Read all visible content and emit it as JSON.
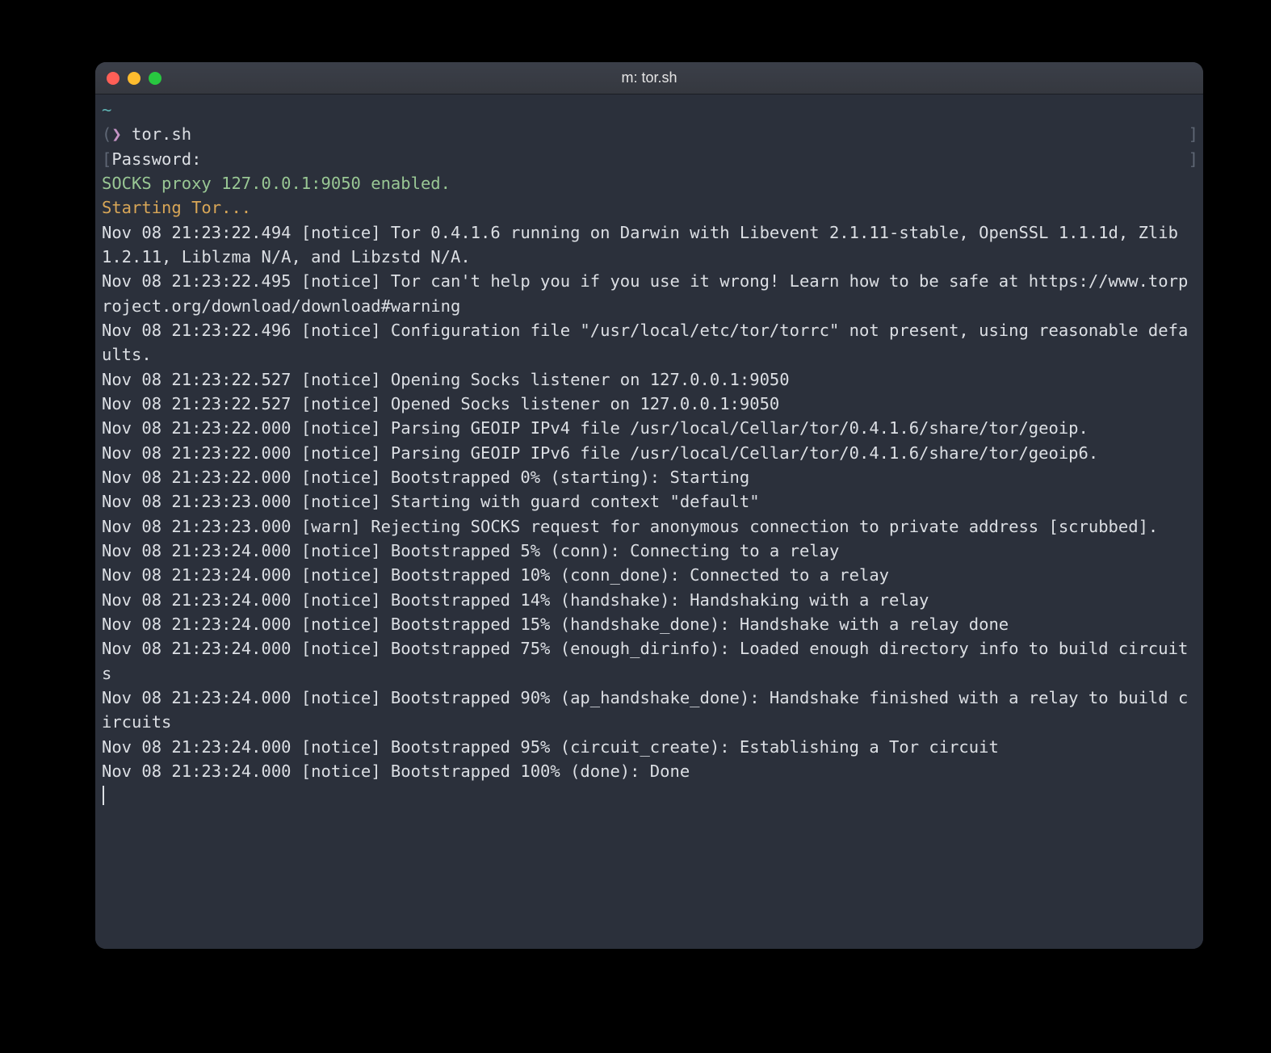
{
  "window": {
    "title": "m: tor.sh"
  },
  "prompt": {
    "cwd": "~",
    "left_bracket": "(",
    "arrow": "❯",
    "command": "tor.sh",
    "right_bracket": "]",
    "password_left": "[",
    "password_label": "Password:",
    "password_right": "]"
  },
  "socks_enabled": "SOCKS proxy 127.0.0.1:9050 enabled.",
  "starting_tor": "Starting Tor...",
  "log_lines": [
    "Nov 08 21:23:22.494 [notice] Tor 0.4.1.6 running on Darwin with Libevent 2.1.11-stable, OpenSSL 1.1.1d, Zlib 1.2.11, Liblzma N/A, and Libzstd N/A.",
    "Nov 08 21:23:22.495 [notice] Tor can't help you if you use it wrong! Learn how to be safe at https://www.torproject.org/download/download#warning",
    "Nov 08 21:23:22.496 [notice] Configuration file \"/usr/local/etc/tor/torrc\" not present, using reasonable defaults.",
    "Nov 08 21:23:22.527 [notice] Opening Socks listener on 127.0.0.1:9050",
    "Nov 08 21:23:22.527 [notice] Opened Socks listener on 127.0.0.1:9050",
    "Nov 08 21:23:22.000 [notice] Parsing GEOIP IPv4 file /usr/local/Cellar/tor/0.4.1.6/share/tor/geoip.",
    "Nov 08 21:23:22.000 [notice] Parsing GEOIP IPv6 file /usr/local/Cellar/tor/0.4.1.6/share/tor/geoip6.",
    "Nov 08 21:23:22.000 [notice] Bootstrapped 0% (starting): Starting",
    "Nov 08 21:23:23.000 [notice] Starting with guard context \"default\"",
    "Nov 08 21:23:23.000 [warn] Rejecting SOCKS request for anonymous connection to private address [scrubbed].",
    "Nov 08 21:23:24.000 [notice] Bootstrapped 5% (conn): Connecting to a relay",
    "Nov 08 21:23:24.000 [notice] Bootstrapped 10% (conn_done): Connected to a relay",
    "Nov 08 21:23:24.000 [notice] Bootstrapped 14% (handshake): Handshaking with a relay",
    "Nov 08 21:23:24.000 [notice] Bootstrapped 15% (handshake_done): Handshake with a relay done",
    "Nov 08 21:23:24.000 [notice] Bootstrapped 75% (enough_dirinfo): Loaded enough directory info to build circuits",
    "Nov 08 21:23:24.000 [notice] Bootstrapped 90% (ap_handshake_done): Handshake finished with a relay to build circuits",
    "Nov 08 21:23:24.000 [notice] Bootstrapped 95% (circuit_create): Establishing a Tor circuit",
    "Nov 08 21:23:24.000 [notice] Bootstrapped 100% (done): Done"
  ]
}
